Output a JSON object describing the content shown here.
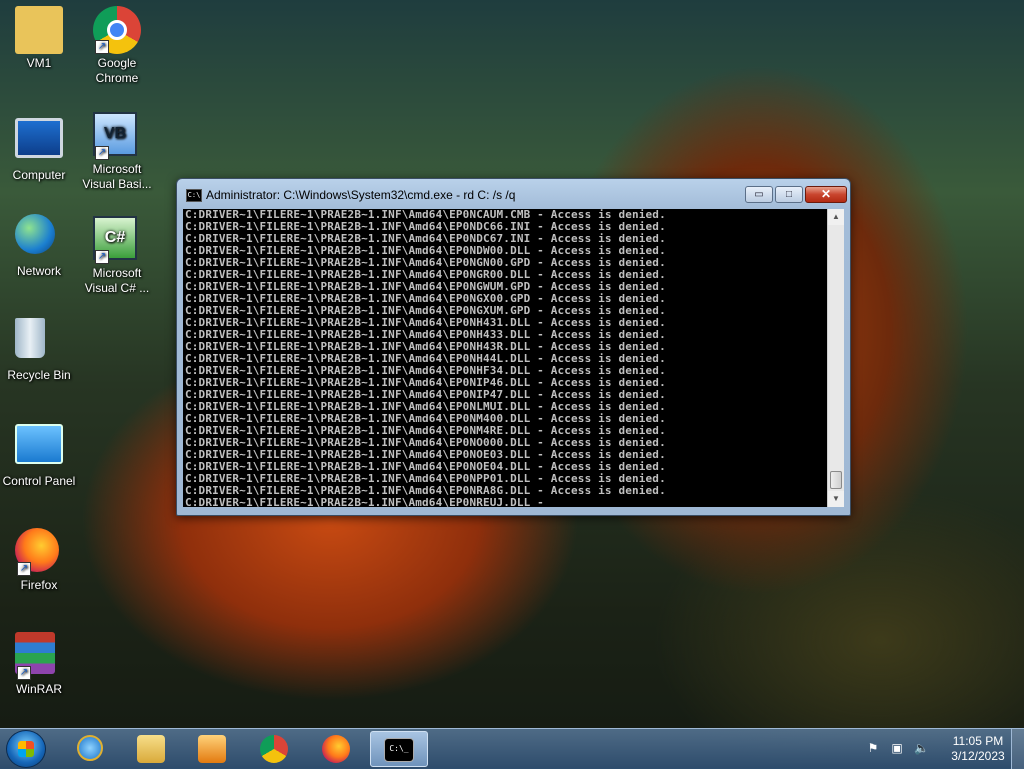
{
  "desktop": {
    "icons": [
      {
        "label": "VM1",
        "icon": "user-folder-icon"
      },
      {
        "label": "Google Chrome",
        "icon": "chrome-icon"
      },
      {
        "label": "Computer",
        "icon": "computer-icon"
      },
      {
        "label": "Microsoft Visual Basi...",
        "icon": "visual-basic-icon"
      },
      {
        "label": "Network",
        "icon": "network-icon"
      },
      {
        "label": "Microsoft Visual C# ...",
        "icon": "visual-csharp-icon"
      },
      {
        "label": "Recycle Bin",
        "icon": "recycle-bin-icon"
      },
      {
        "label": "Control Panel",
        "icon": "control-panel-icon"
      },
      {
        "label": "Firefox",
        "icon": "firefox-icon"
      },
      {
        "label": "WinRAR",
        "icon": "winrar-icon"
      }
    ]
  },
  "cmd_window": {
    "title": "Administrator: C:\\Windows\\System32\\cmd.exe - rd  C: /s /q",
    "title_icon_text": "C:\\",
    "minimize_glyph": "▭",
    "maximize_glyph": "□",
    "close_glyph": "✕",
    "lines": [
      "C:DRIVER~1\\FILERE~1\\PRAE2B~1.INF\\Amd64\\EP0NCAUM.CMB - Access is denied.",
      "C:DRIVER~1\\FILERE~1\\PRAE2B~1.INF\\Amd64\\EP0NDC66.INI - Access is denied.",
      "C:DRIVER~1\\FILERE~1\\PRAE2B~1.INF\\Amd64\\EP0NDC67.INI - Access is denied.",
      "C:DRIVER~1\\FILERE~1\\PRAE2B~1.INF\\Amd64\\EP0NDW00.DLL - Access is denied.",
      "C:DRIVER~1\\FILERE~1\\PRAE2B~1.INF\\Amd64\\EP0NGN00.GPD - Access is denied.",
      "C:DRIVER~1\\FILERE~1\\PRAE2B~1.INF\\Amd64\\EP0NGR00.DLL - Access is denied.",
      "C:DRIVER~1\\FILERE~1\\PRAE2B~1.INF\\Amd64\\EP0NGWUM.GPD - Access is denied.",
      "C:DRIVER~1\\FILERE~1\\PRAE2B~1.INF\\Amd64\\EP0NGX00.GPD - Access is denied.",
      "C:DRIVER~1\\FILERE~1\\PRAE2B~1.INF\\Amd64\\EP0NGXUM.GPD - Access is denied.",
      "C:DRIVER~1\\FILERE~1\\PRAE2B~1.INF\\Amd64\\EP0NH431.DLL - Access is denied.",
      "C:DRIVER~1\\FILERE~1\\PRAE2B~1.INF\\Amd64\\EP0NH433.DLL - Access is denied.",
      "C:DRIVER~1\\FILERE~1\\PRAE2B~1.INF\\Amd64\\EP0NH43R.DLL - Access is denied.",
      "C:DRIVER~1\\FILERE~1\\PRAE2B~1.INF\\Amd64\\EP0NH44L.DLL - Access is denied.",
      "C:DRIVER~1\\FILERE~1\\PRAE2B~1.INF\\Amd64\\EP0NHF34.DLL - Access is denied.",
      "C:DRIVER~1\\FILERE~1\\PRAE2B~1.INF\\Amd64\\EP0NIP46.DLL - Access is denied.",
      "C:DRIVER~1\\FILERE~1\\PRAE2B~1.INF\\Amd64\\EP0NIP47.DLL - Access is denied.",
      "C:DRIVER~1\\FILERE~1\\PRAE2B~1.INF\\Amd64\\EP0NLMUI.DLL - Access is denied.",
      "C:DRIVER~1\\FILERE~1\\PRAE2B~1.INF\\Amd64\\EP0NM400.DLL - Access is denied.",
      "C:DRIVER~1\\FILERE~1\\PRAE2B~1.INF\\Amd64\\EP0NM4RE.DLL - Access is denied.",
      "C:DRIVER~1\\FILERE~1\\PRAE2B~1.INF\\Amd64\\EP0NO000.DLL - Access is denied.",
      "C:DRIVER~1\\FILERE~1\\PRAE2B~1.INF\\Amd64\\EP0NOE03.DLL - Access is denied.",
      "C:DRIVER~1\\FILERE~1\\PRAE2B~1.INF\\Amd64\\EP0NOE04.DLL - Access is denied.",
      "C:DRIVER~1\\FILERE~1\\PRAE2B~1.INF\\Amd64\\EP0NPP01.DLL - Access is denied.",
      "C:DRIVER~1\\FILERE~1\\PRAE2B~1.INF\\Amd64\\EP0NRA8G.DLL - Access is denied.",
      "C:DRIVER~1\\FILERE~1\\PRAE2B~1.INF\\Amd64\\EP0NREUJ.DLL -"
    ]
  },
  "taskbar": {
    "start_icon": "windows-start-icon",
    "items": [
      {
        "name": "task-ie",
        "icon": "internet-explorer-icon"
      },
      {
        "name": "task-explorer",
        "icon": "file-explorer-icon"
      },
      {
        "name": "task-media",
        "icon": "media-player-icon"
      },
      {
        "name": "task-chrome",
        "icon": "chrome-icon"
      },
      {
        "name": "task-firefox",
        "icon": "firefox-icon"
      },
      {
        "name": "task-cmd",
        "icon": "command-prompt-icon",
        "text": "C:\\_",
        "active": true
      }
    ],
    "tray": {
      "flag_icon": "action-center-flag-icon",
      "network_icon": "network-status-icon",
      "volume_icon": "speaker-icon",
      "time": "11:05 PM",
      "date": "3/12/2023"
    }
  }
}
